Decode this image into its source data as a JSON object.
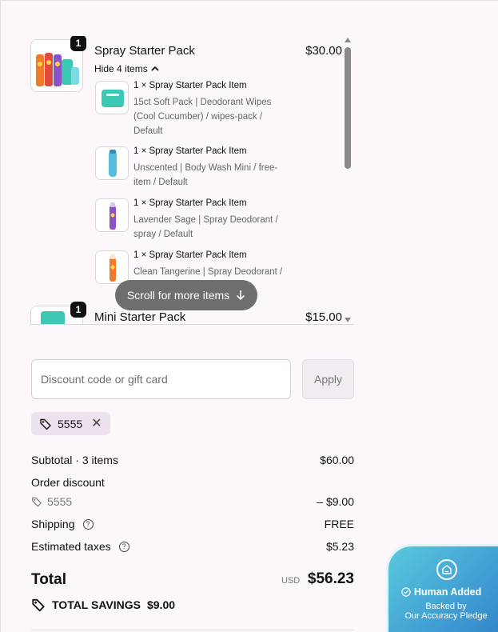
{
  "cart": {
    "products": [
      {
        "quantity": "1",
        "title": "Spray Starter Pack",
        "price": "$30.00",
        "toggle_label": "Hide 4 items",
        "sub_items": [
          {
            "name": "1 × Spray Starter Pack Item",
            "description": "15ct Soft Pack | Deodorant Wipes (Cool Cucumber) / wipes-pack / Default"
          },
          {
            "name": "1 × Spray Starter Pack Item",
            "description": "Unscented | Body Wash Mini / free-item / Default"
          },
          {
            "name": "1 × Spray Starter Pack Item",
            "description": "Lavender Sage | Spray Deodorant / spray / Default"
          },
          {
            "name": "1 × Spray Starter Pack Item",
            "description": "Clean Tangerine | Spray Deodorant /"
          }
        ]
      },
      {
        "quantity": "1",
        "title": "Mini Starter Pack",
        "price": "$15.00"
      }
    ],
    "scroll_hint": "Scroll for more items"
  },
  "discount": {
    "placeholder": "Discount code or gift card",
    "apply_label": "Apply",
    "applied_code": "5555"
  },
  "summary": {
    "subtotal_label": "Subtotal · 3 items",
    "subtotal_value": "$60.00",
    "order_discount_label": "Order discount",
    "order_discount_code": "5555",
    "order_discount_value": "– $9.00",
    "shipping_label": "Shipping",
    "shipping_value": "FREE",
    "taxes_label": "Estimated taxes",
    "taxes_value": "$5.23",
    "total_label": "Total",
    "currency": "USD",
    "total_value": "$56.23",
    "savings_label": "TOTAL SAVINGS",
    "savings_value": "$9.00"
  },
  "trust_badge": {
    "title": "Human Added",
    "line1": "Backed by",
    "line2": "Our Accuracy Pledge"
  },
  "colors": {
    "background": "#fcf7fb",
    "badge_gradient_start": "#59c9dd",
    "badge_gradient_end": "#2f7fc6",
    "teal_product": "#3ec7b4",
    "purple_product": "#8a52c4",
    "orange_product": "#f07a2c"
  }
}
